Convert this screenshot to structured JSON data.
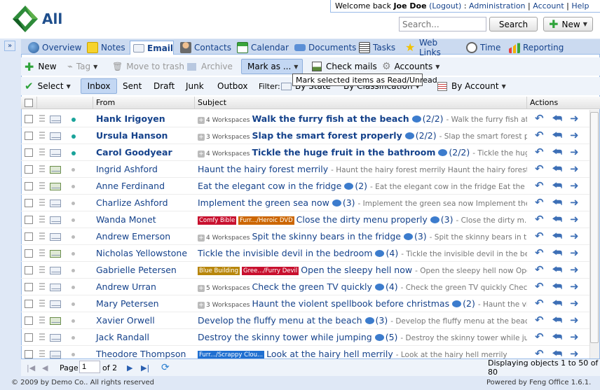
{
  "app": {
    "logo_text": "All"
  },
  "topbar": {
    "welcome": "Welcome back",
    "user": "Joe Doe",
    "logout": "(Logout)",
    "sep1": ":",
    "admin": "Administration",
    "sep2": "|",
    "account": "Account",
    "sep3": "|",
    "help": "Help"
  },
  "search": {
    "placeholder": "Search...",
    "button": "Search"
  },
  "new_button": "New",
  "tabs": [
    {
      "label": "Overview"
    },
    {
      "label": "Notes"
    },
    {
      "label": "Email"
    },
    {
      "label": "Contacts"
    },
    {
      "label": "Calendar"
    },
    {
      "label": "Documents"
    },
    {
      "label": "Tasks"
    },
    {
      "label": "Web Links"
    },
    {
      "label": "Time"
    },
    {
      "label": "Reporting"
    }
  ],
  "toolbar1": {
    "new": "New",
    "tag": "Tag",
    "trash": "Move to trash",
    "archive": "Archive",
    "mark_as": "Mark as ...",
    "check_mails": "Check mails",
    "accounts": "Accounts"
  },
  "tooltip": "Mark selected items as Read/Unread",
  "toolbar2": {
    "select": "Select",
    "inbox": "Inbox",
    "sent": "Sent",
    "draft": "Draft",
    "junk": "Junk",
    "outbox": "Outbox",
    "filter": "Filter:",
    "by_state": "By State",
    "by_classification": "By Classification",
    "by_account": "By Account"
  },
  "columns": {
    "from": "From",
    "subject": "Subject",
    "actions": "Actions"
  },
  "rows": [
    {
      "from": "Hank Irigoyen",
      "ws": "4 Workspaces",
      "tags": [],
      "subject": "Walk the furry fish at the beach",
      "count": "(2/2)",
      "preview": "- Walk the furry fish at th...",
      "unread": true,
      "fwd": false
    },
    {
      "from": "Ursula Hanson",
      "ws": "3 Workspaces",
      "tags": [],
      "subject": "Slap the smart forest properly",
      "count": "(2/2)",
      "preview": "- Slap the smart forest prop...",
      "unread": true,
      "fwd": false
    },
    {
      "from": "Carol Goodyear",
      "ws": "4 Workspaces",
      "tags": [],
      "subject": "Tickle the huge fruit in the bathroom",
      "count": "(2/2)",
      "preview": "- Tickle the huge f...",
      "unread": true,
      "fwd": false
    },
    {
      "from": "Ingrid Ashford",
      "ws": "",
      "tags": [],
      "subject": "Haunt the hairy forest merrily",
      "count": "",
      "preview": "- Haunt the hairy forest merrily Haunt the hairy forest merr...",
      "unread": false,
      "fwd": true
    },
    {
      "from": "Anne Ferdinand",
      "ws": "",
      "tags": [],
      "subject": "Eat the elegant cow in the fridge",
      "count": "(2)",
      "preview": "- Eat the elegant cow in the fridge Eat the eleg...",
      "unread": false,
      "fwd": true
    },
    {
      "from": "Charlize Ashford",
      "ws": "",
      "tags": [],
      "subject": "Implement the green sea now",
      "count": "(3)",
      "preview": "- Implement the green sea now Implement the gr...",
      "unread": false,
      "fwd": false
    },
    {
      "from": "Wanda Monet",
      "ws": "",
      "tags": [
        {
          "label": "Comfy Bible",
          "color": "#c8102e"
        },
        {
          "label": "Furr.../Heroic DVD",
          "color": "#cc6600"
        }
      ],
      "subject": "Close the dirty menu properly",
      "count": "(3)",
      "preview": "- Close the dirty m...",
      "unread": false,
      "fwd": false
    },
    {
      "from": "Andrew Emerson",
      "ws": "4 Workspaces",
      "tags": [],
      "subject": "Spit the skinny bears in the fridge",
      "count": "(3)",
      "preview": "- Spit the skinny bears in the...",
      "unread": false,
      "fwd": false
    },
    {
      "from": "Nicholas Yellowstone",
      "ws": "",
      "tags": [],
      "subject": "Tickle the invisible devil in the bedroom",
      "count": "(4)",
      "preview": "- Tickle the invisible devil in the bedroo...",
      "unread": false,
      "fwd": true
    },
    {
      "from": "Gabrielle Petersen",
      "ws": "",
      "tags": [
        {
          "label": "Blue Building",
          "color": "#b8860b"
        },
        {
          "label": "Gree.../Furry Devil",
          "color": "#c8102e"
        }
      ],
      "subject": "Open the sleepy hell now",
      "count": "",
      "preview": "- Open the sleepy hell now Ope...",
      "unread": false,
      "fwd": false
    },
    {
      "from": "Andrew Urran",
      "ws": "5 Workspaces",
      "tags": [],
      "subject": "Check the green TV quickly",
      "count": "(4)",
      "preview": "- Check the green TV quickly Check...",
      "unread": false,
      "fwd": false
    },
    {
      "from": "Mary Petersen",
      "ws": "3 Workspaces",
      "tags": [],
      "subject": "Haunt the violent spellbook before christmas",
      "count": "(2)",
      "preview": "- Haunt the viol...",
      "unread": false,
      "fwd": false
    },
    {
      "from": "Xavier Orwell",
      "ws": "",
      "tags": [],
      "subject": "Develop the fluffy menu at the beach",
      "count": "(3)",
      "preview": "- Develop the fluffy menu at the beach D...",
      "unread": false,
      "fwd": true
    },
    {
      "from": "Jack Randall",
      "ws": "",
      "tags": [],
      "subject": "Destroy the skinny tower while jumping",
      "count": "(5)",
      "preview": "- Destroy the skinny tower while jum...",
      "unread": false,
      "fwd": false
    },
    {
      "from": "Theodore Thompson",
      "ws": "",
      "tags": [
        {
          "label": "Furr.../Scrappy Clou...",
          "color": "#1f6fd1"
        }
      ],
      "subject": "Look at the hairy hell merrily",
      "count": "",
      "preview": "- Look at the hairy hell merrily",
      "unread": false,
      "fwd": false
    }
  ],
  "pager": {
    "page_label": "Page",
    "page_value": "1",
    "of": "of 2",
    "displaying": "Displaying objects 1 to 50 of 80"
  },
  "footer": {
    "copyright": "© 2009 by Demo Co.. All rights reserved",
    "powered": "Powered by Feng Office 1.6.1."
  }
}
